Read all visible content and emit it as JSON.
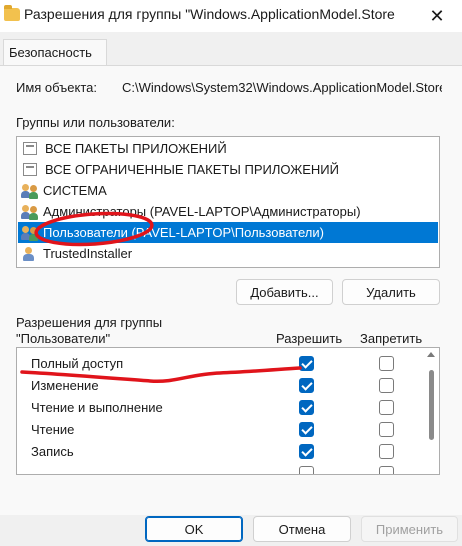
{
  "window": {
    "title": "Разрешения для группы \"Windows.ApplicationModel.Store",
    "close_glyph": "✕"
  },
  "tabs": [
    {
      "label": "Безопасность"
    }
  ],
  "object": {
    "label": "Имя объекта:",
    "value": "C:\\Windows\\System32\\Windows.ApplicationModel.Store"
  },
  "groups": {
    "label": "Группы или пользователи:",
    "items": [
      {
        "label": "ВСЕ ПАКЕТЫ ПРИЛОЖЕНИЙ",
        "icon": "package-icon",
        "selected": false
      },
      {
        "label": "ВСЕ ОГРАНИЧЕННЫЕ ПАКЕТЫ ПРИЛОЖЕНИЙ",
        "icon": "package-icon",
        "selected": false
      },
      {
        "label": "СИСТЕМА",
        "icon": "users-icon",
        "selected": false
      },
      {
        "label": "Администраторы (PAVEL-LAPTOP\\Администраторы)",
        "icon": "users-icon",
        "selected": false
      },
      {
        "label": "Пользователи (PAVEL-LAPTOP\\Пользователи)",
        "icon": "users-icon",
        "selected": true
      },
      {
        "label": "TrustedInstaller",
        "icon": "user-icon",
        "selected": false
      }
    ],
    "add_label": "Добавить...",
    "remove_label": "Удалить"
  },
  "permissions": {
    "label_line1": "Разрешения для группы",
    "label_line2": "\"Пользователи\"",
    "allow_header": "Разрешить",
    "deny_header": "Запретить",
    "rows": [
      {
        "label": "Полный доступ",
        "allow": true,
        "deny": false
      },
      {
        "label": "Изменение",
        "allow": true,
        "deny": false
      },
      {
        "label": "Чтение и выполнение",
        "allow": true,
        "deny": false
      },
      {
        "label": "Чтение",
        "allow": true,
        "deny": false
      },
      {
        "label": "Запись",
        "allow": true,
        "deny": false
      },
      {
        "label": "",
        "allow": false,
        "deny": false
      }
    ]
  },
  "footer": {
    "ok_label": "OK",
    "cancel_label": "Отмена",
    "apply_label": "Применить"
  },
  "colors": {
    "selection": "#0078d4",
    "checkbox": "#0067c0",
    "annotation": "#e0141b"
  }
}
